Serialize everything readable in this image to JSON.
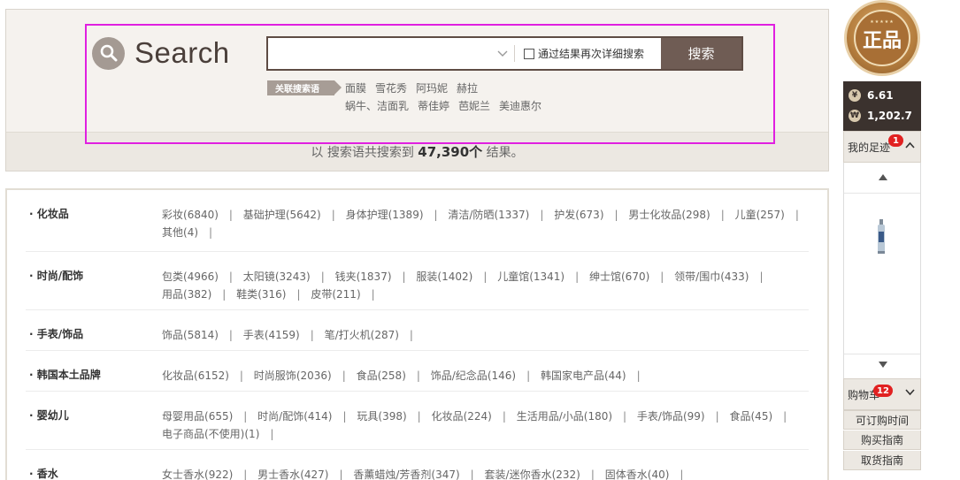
{
  "search": {
    "logo_text": "Search",
    "placeholder": "",
    "refine_label": "通过结果再次详细搜索",
    "button_label": "搜索"
  },
  "related": {
    "label": "关联搜索语",
    "keywords": [
      "面膜",
      "雪花秀",
      "阿玛妮",
      "赫拉",
      "蜗牛、洁面乳",
      "蒂佳婷",
      "芭妮兰",
      "美迪惠尔"
    ]
  },
  "result": {
    "prefix": "以 搜索语共搜索到",
    "count": "47,390个",
    "suffix": "结果。"
  },
  "categories": [
    {
      "name": "· 化妆品",
      "items": [
        {
          "label": "彩妆",
          "count": "(6840)"
        },
        {
          "label": "基础护理",
          "count": "(5642)"
        },
        {
          "label": "身体护理",
          "count": "(1389)"
        },
        {
          "label": "清洁/防晒",
          "count": "(1337)"
        },
        {
          "label": "护发",
          "count": "(673)"
        },
        {
          "label": "男士化妆品",
          "count": "(298)"
        },
        {
          "label": "儿童",
          "count": "(257)"
        },
        {
          "label": "其他",
          "count": "(4)"
        }
      ]
    },
    {
      "name": "· 时尚/配饰",
      "items": [
        {
          "label": "包类",
          "count": "(4966)"
        },
        {
          "label": "太阳镜",
          "count": "(3243)"
        },
        {
          "label": "钱夹",
          "count": "(1837)"
        },
        {
          "label": "服装",
          "count": "(1402)"
        },
        {
          "label": "儿童馆",
          "count": "(1341)"
        },
        {
          "label": "绅士馆",
          "count": "(670)"
        },
        {
          "label": "领带/围巾",
          "count": "(433)"
        },
        {
          "label": "用品",
          "count": "(382)"
        },
        {
          "label": "鞋类",
          "count": "(316)"
        },
        {
          "label": "皮带",
          "count": "(211)"
        }
      ]
    },
    {
      "name": "· 手表/饰品",
      "items": [
        {
          "label": "饰品",
          "count": "(5814)"
        },
        {
          "label": "手表",
          "count": "(4159)"
        },
        {
          "label": "笔/打火机",
          "count": "(287)"
        }
      ]
    },
    {
      "name": "· 韩国本土品牌",
      "items": [
        {
          "label": "化妆品",
          "count": "(6152)"
        },
        {
          "label": "时尚服饰",
          "count": "(2036)"
        },
        {
          "label": "食品",
          "count": "(258)"
        },
        {
          "label": "饰品/纪念品",
          "count": "(146)"
        },
        {
          "label": "韩国家电产品",
          "count": "(44)"
        }
      ]
    },
    {
      "name": "· 婴幼儿",
      "items": [
        {
          "label": "母婴用品",
          "count": "(655)"
        },
        {
          "label": "时尚/配饰",
          "count": "(414)"
        },
        {
          "label": "玩具",
          "count": "(398)"
        },
        {
          "label": "化妆品",
          "count": "(224)"
        },
        {
          "label": "生活用品/小品",
          "count": "(180)"
        },
        {
          "label": "手表/饰品",
          "count": "(99)"
        },
        {
          "label": "食品",
          "count": "(45)"
        },
        {
          "label": "电子商品(不使用)",
          "count": "(1)"
        }
      ]
    },
    {
      "name": "· 香水",
      "items": [
        {
          "label": "女士香水",
          "count": "(922)"
        },
        {
          "label": "男士香水",
          "count": "(427)"
        },
        {
          "label": "香薰蜡烛/芳香剂",
          "count": "(347)"
        },
        {
          "label": "套装/迷你香水",
          "count": "(232)"
        },
        {
          "label": "固体香水",
          "count": "(40)"
        }
      ]
    }
  ],
  "sidebar": {
    "badge_text": "正品",
    "rate_cny": "6.61",
    "rate_krw": "1,202.7",
    "rate_cny_icon": "¥",
    "rate_krw_icon": "₩",
    "recent_label": "我的足迹",
    "recent_count": "1",
    "cart_label": "购物车",
    "cart_count": "12",
    "links": [
      "可订购时间",
      "购买指南",
      "取货指南"
    ]
  },
  "colors": {
    "highlight": "#e020e0",
    "button": "#6f5c54",
    "badge_red": "#e12121"
  }
}
